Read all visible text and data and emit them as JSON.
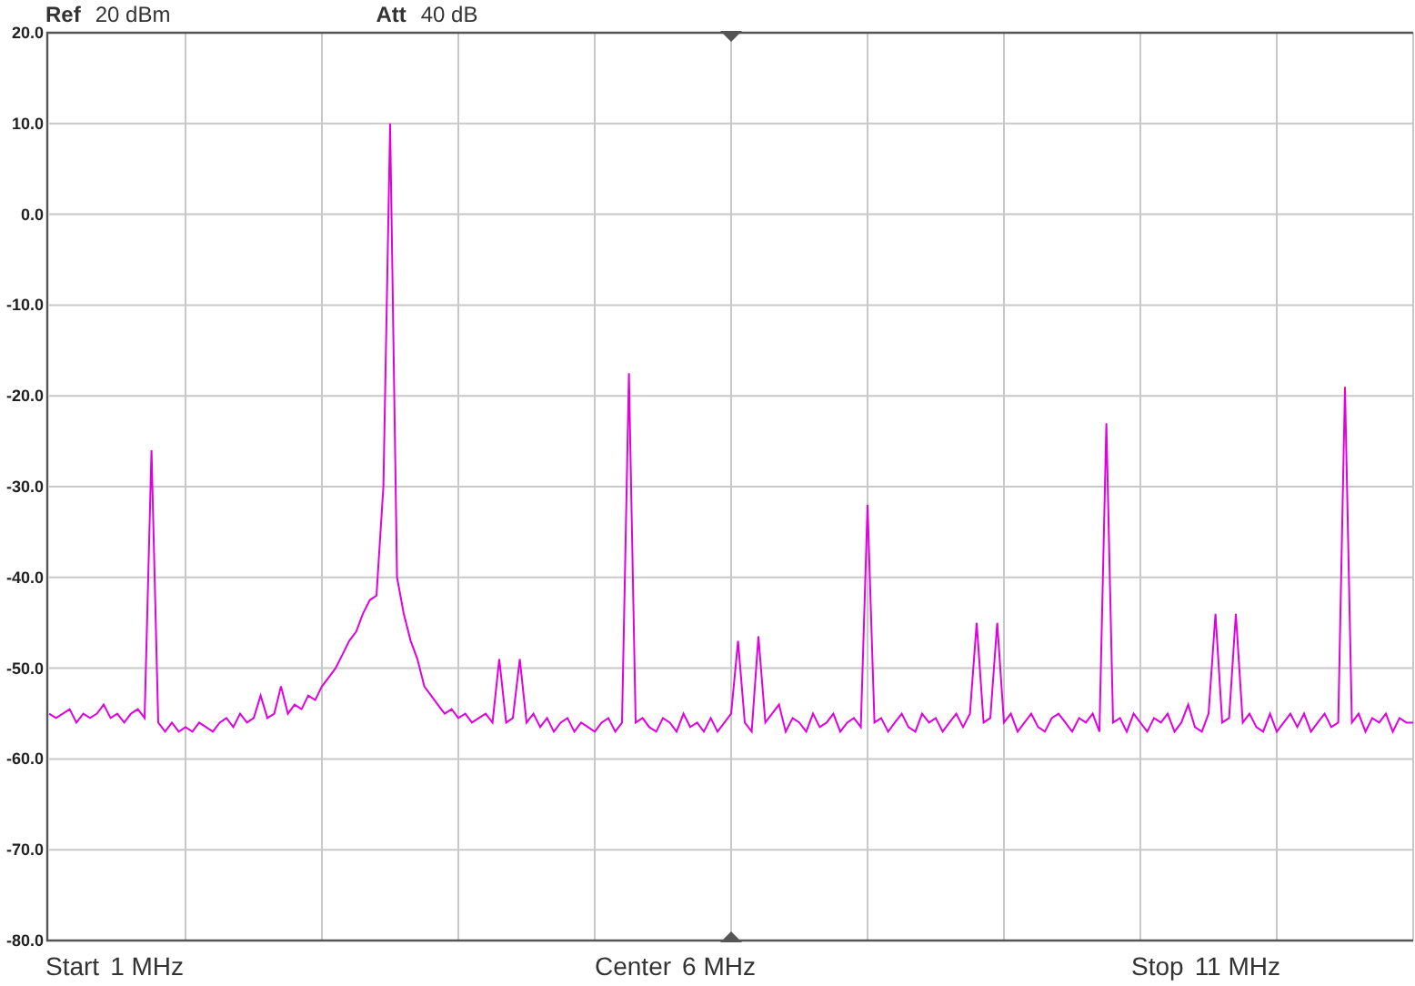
{
  "header": {
    "ref_label": "Ref",
    "ref_value": "20 dBm",
    "att_label": "Att",
    "att_value": "40 dB"
  },
  "spectrum": {
    "chart_data": {
      "type": "line",
      "grid": true,
      "ylim": [
        -80,
        20
      ],
      "yticks": [
        {
          "value": 20,
          "label": "20.0"
        },
        {
          "value": 10,
          "label": "10.0"
        },
        {
          "value": 0,
          "label": "0.0"
        },
        {
          "value": -10,
          "label": "-10.0"
        },
        {
          "value": -20,
          "label": "-20.0"
        },
        {
          "value": -30,
          "label": "-30.0"
        },
        {
          "value": -40,
          "label": "-40.0"
        },
        {
          "value": -50,
          "label": "-50.0"
        },
        {
          "value": -60,
          "label": "-60.0"
        },
        {
          "value": -70,
          "label": "-70.0"
        },
        {
          "value": -80,
          "label": "-80.0"
        }
      ],
      "categories": [
        null,
        null,
        null,
        null,
        null,
        null,
        null,
        null,
        null,
        null,
        null,
        null,
        null,
        null,
        null,
        null,
        null,
        null,
        null,
        null,
        null,
        null,
        null,
        null,
        null,
        null,
        null,
        null,
        null,
        null,
        null,
        null,
        null,
        null,
        null,
        null,
        null,
        null,
        null,
        null,
        null,
        null,
        null,
        null,
        null,
        null,
        null,
        null,
        null,
        null,
        null,
        null,
        null,
        null,
        null,
        null,
        null,
        null,
        null,
        null,
        null,
        null,
        null,
        null,
        null,
        null,
        null,
        null,
        null,
        null,
        null,
        null,
        null,
        null,
        null,
        null,
        null,
        null,
        null,
        null,
        null,
        null,
        null,
        null,
        null,
        null,
        null,
        null,
        null,
        null,
        null,
        null,
        null,
        null,
        null,
        null,
        null,
        null,
        null,
        null,
        null,
        null,
        null,
        null,
        null,
        null,
        null,
        null,
        null,
        null,
        null,
        null,
        null,
        null,
        null,
        null,
        null,
        null,
        null,
        null,
        null,
        null,
        null,
        null,
        null,
        null,
        null,
        null,
        null,
        null,
        null,
        null,
        null,
        null,
        null,
        null,
        null,
        null,
        null,
        null,
        null,
        null,
        null,
        null,
        null,
        null,
        null,
        null,
        null,
        null,
        null,
        null,
        null,
        null,
        null,
        null,
        null,
        null,
        null,
        null,
        null,
        null,
        null,
        null,
        null,
        null,
        null,
        null,
        null,
        null,
        null,
        null,
        null,
        null,
        null,
        null,
        null,
        null,
        null,
        null,
        null,
        null,
        null,
        null,
        null,
        null,
        null,
        null,
        null,
        null,
        null,
        null,
        null,
        null,
        null,
        null,
        null,
        null,
        null,
        null,
        null
      ],
      "series": [
        {
          "color": "#e000e0",
          "values": [
            -55,
            -55.5,
            -55,
            -54.5,
            -56,
            -55,
            -55.5,
            -55,
            -54,
            -55.5,
            -55,
            -56,
            -55,
            -54.5,
            -55.5,
            -26,
            -56,
            -57,
            -56,
            -57,
            -56.5,
            -57,
            -56,
            -56.5,
            -57,
            -56,
            -55.5,
            -56.5,
            -55,
            -56,
            -55.5,
            -53,
            -55.5,
            -55,
            -52,
            -55,
            -54,
            -54.5,
            -53,
            -53.5,
            -52,
            -51,
            -50,
            -48.5,
            -47,
            -46,
            -44,
            -42.5,
            -42,
            -30,
            10,
            -40,
            -44,
            -47,
            -49,
            -52,
            -53,
            -54,
            -55,
            -54.5,
            -55.5,
            -55,
            -56,
            -55.5,
            -55,
            -56,
            -49,
            -56,
            -55.5,
            -49,
            -56,
            -55,
            -56.5,
            -55.5,
            -57,
            -56,
            -55.5,
            -57,
            -56,
            -56.5,
            -57,
            -56,
            -55.5,
            -57,
            -56,
            -17.5,
            -56,
            -55.5,
            -56.5,
            -57,
            -55.5,
            -56,
            -57,
            -55,
            -56.5,
            -56,
            -57,
            -55.5,
            -57,
            -56,
            -55,
            -47,
            -56,
            -57,
            -46.5,
            -56,
            -55,
            -54,
            -57,
            -55.5,
            -56,
            -57,
            -55,
            -56.5,
            -56,
            -55,
            -57,
            -56,
            -55.5,
            -56.5,
            -32,
            -56,
            -55.5,
            -57,
            -56,
            -55,
            -56.5,
            -57,
            -55,
            -56,
            -55.5,
            -57,
            -56,
            -55,
            -56.5,
            -55,
            -45,
            -56,
            -55.5,
            -45,
            -56,
            -55,
            -57,
            -56,
            -55,
            -56.5,
            -57,
            -55.5,
            -55,
            -56,
            -57,
            -55.5,
            -56,
            -55,
            -57,
            -23,
            -56,
            -55.5,
            -57,
            -55,
            -56,
            -57,
            -55.5,
            -56,
            -55,
            -57,
            -56,
            -54,
            -56.5,
            -57,
            -55,
            -44,
            -56,
            -55.5,
            -44,
            -56,
            -55,
            -56.5,
            -57,
            -55,
            -57,
            -56,
            -55,
            -56.5,
            -55,
            -57,
            -56,
            -55,
            -56.5,
            -56,
            -19,
            -56,
            -55,
            -57,
            -55.5,
            -56,
            -55,
            -57,
            -55.5,
            -56,
            -56
          ]
        }
      ]
    }
  },
  "footer": {
    "start_label": "Start",
    "start_value": "1 MHz",
    "center_label": "Center",
    "center_value": "6 MHz",
    "stop_label": "Stop",
    "stop_value": "11 MHz"
  }
}
